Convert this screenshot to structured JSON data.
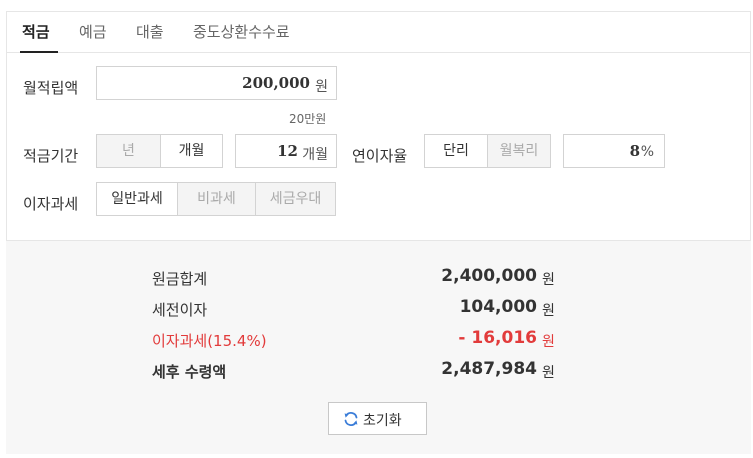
{
  "tabs": [
    {
      "label": "적금",
      "active": true
    },
    {
      "label": "예금",
      "active": false
    },
    {
      "label": "대출",
      "active": false
    },
    {
      "label": "중도상환수수료",
      "active": false
    }
  ],
  "monthly_deposit": {
    "label": "월적립액",
    "value": "200,000",
    "unit": "원",
    "hint": "20만원"
  },
  "period": {
    "label": "적금기간",
    "options": [
      "년",
      "개월"
    ],
    "selected": "개월",
    "value": "12",
    "unit": "개월"
  },
  "rate": {
    "label": "연이자율",
    "options": [
      "단리",
      "월복리"
    ],
    "selected": "단리",
    "value": "8",
    "unit": "%"
  },
  "tax": {
    "label": "이자과세",
    "options": [
      "일반과세",
      "비과세",
      "세금우대"
    ],
    "selected": "일반과세"
  },
  "results": [
    {
      "label": "원금합계",
      "value": "2,400,000",
      "unit": "원"
    },
    {
      "label": "세전이자",
      "value": "104,000",
      "unit": "원"
    },
    {
      "label": "이자과세(15.4%)",
      "value": "- 16,016",
      "unit": "원"
    },
    {
      "label": "세후 수령액",
      "value": "2,487,984",
      "unit": "원"
    }
  ],
  "reset_button": {
    "label": "초기화",
    "icon": "refresh-icon"
  },
  "colors": {
    "accent_red": "#e23b3b",
    "text": "#333333",
    "result_bg": "#f7f7f7",
    "refresh_icon": "#3b7dd8"
  }
}
